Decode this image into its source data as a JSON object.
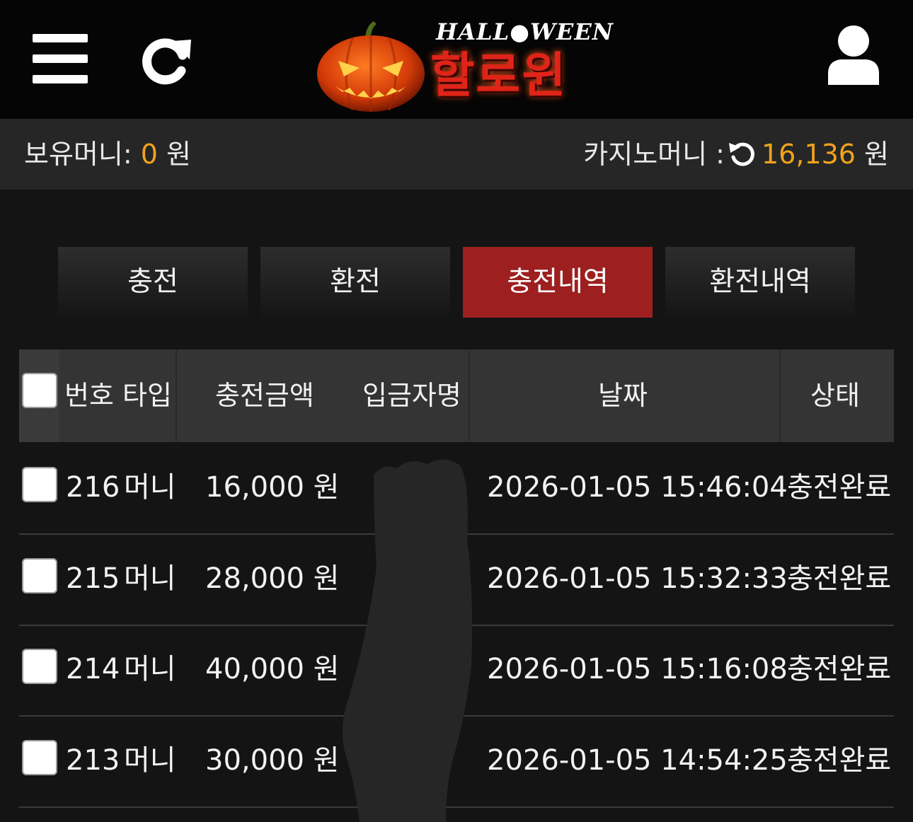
{
  "header": {
    "logo_top": "HALL●WEEN",
    "logo_title": "할로윈",
    "icons": {
      "menu": "menu-icon",
      "refresh": "refresh-icon",
      "user": "user-icon",
      "logo": "pumpkin-icon"
    }
  },
  "wallet": {
    "holding_label": "보유머니:",
    "holding_value": "0",
    "holding_unit": "원",
    "casino_label": "카지노머니 :",
    "casino_value": "16,136",
    "casino_unit": "원"
  },
  "tabs": [
    "충전",
    "환전",
    "충전내역",
    "환전내역"
  ],
  "active_tab": "충전내역",
  "table": {
    "columns": [
      "번호 타입",
      "충전금액",
      "입금자명",
      "날짜",
      "상태"
    ],
    "rows": [
      {
        "no": "216",
        "type": "머니",
        "amount": "16,000 원",
        "depositor": "",
        "date": "2026-01-05 15:46:04",
        "status": "충전완료"
      },
      {
        "no": "215",
        "type": "머니",
        "amount": "28,000 원",
        "depositor": "",
        "date": "2026-01-05 15:32:33",
        "status": "충전완료"
      },
      {
        "no": "214",
        "type": "머니",
        "amount": "40,000 원",
        "depositor": "",
        "date": "2026-01-05 15:16:08",
        "status": "충전완료"
      },
      {
        "no": "213",
        "type": "머니",
        "amount": "30,000 원",
        "depositor": "",
        "date": "2026-01-05 14:54:25",
        "status": "충전완료"
      }
    ]
  },
  "colors": {
    "accent": "#f0a31c",
    "active_tab": "#9d1f20",
    "background": "#141414"
  }
}
